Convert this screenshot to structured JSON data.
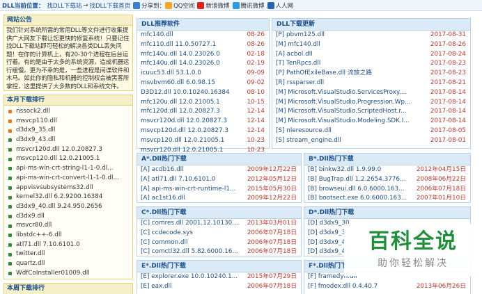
{
  "topbar": {
    "location_label": "DLL当前位置：",
    "crumb1": "找DLL下载站",
    "arrow": "→",
    "crumb2": "找DLL下载首页",
    "share_label": "分享到：",
    "share_items": [
      "QQ空间",
      "新浪微博",
      "腾讯微博",
      "人人网"
    ],
    "share_colors": [
      "#f5a623",
      "#e2231a",
      "#2b9ae3",
      "#2a62b0"
    ]
  },
  "notice": {
    "title": "网站公告",
    "text": "我们针对系统所需的常用DLL等文件进行收集提供广大网友下载让您更快的修复系统！只要记住找DLL下载站即可轻松的解决各类DLL丢失问题！在你的计算机上，有20-30个进程在后台运行着。有的是由于太多的系统资源，造成机器运行缓慢。更为不幸的是，一些进程是间谍软件和木马。如此你的隐私和机器的控制权会被黑客所掌控，这里提供了大多数的DLL和系统文件。"
  },
  "ranking": {
    "title": "本月下载排行",
    "items": [
      "nssock2.dll",
      "msvcp110.dll",
      "d3dx9_35.dll",
      "d3dx9_43.dll",
      "msvcr120d.dll 12.0.20827.3",
      "msvcp120.dll 12.0.21005.1",
      "api-ms-win-crt-string-l1-1-0.dl...",
      "api-ms-win-crt-convert-l1-1-0.dl...",
      "appvisvsubsystems32.dll",
      "kernel32.dll 6.2.9200.16384",
      "d3dx9_40.dll 9.24.950.2656",
      "d3dx9.dll",
      "msvcr80.dll",
      "libstdc++-6.dll",
      "atl71.dll 7.10.6101.0",
      "twitter.dll",
      "quartz.dll",
      "WdfCoInstaller01009.dll"
    ],
    "dot_colors": [
      "#e8761c",
      "#e8761c",
      "#e8761c",
      "#2e8b3a",
      "#2e8b3a",
      "#2e8b3a",
      "#2e8b3a",
      "#2e8b3a",
      "#2e8b3a",
      "#2e8b3a",
      "#2e8b3a",
      "#2e8b3a",
      "#2e8b3a",
      "#2e8b3a",
      "#2e8b3a",
      "#2e8b3a",
      "#2e8b3a",
      "#2e8b3a"
    ]
  },
  "ranking2": {
    "title": "本周下载排行"
  },
  "recommend": {
    "title": "DLL推荐软件",
    "rows": [
      {
        "name": "mfc140.dll",
        "date": "08-26"
      },
      {
        "name": "mfc110.dll 11.0.50727.1",
        "date": "08-26"
      },
      {
        "name": "mfc140u.dll 14.0.23026.0",
        "date": "02-18"
      },
      {
        "name": "mfc140u.dll 14.0.23026.0",
        "date": "02-19"
      },
      {
        "name": "icuuc53.dll 53.1.0.0",
        "date": "09-09"
      },
      {
        "name": "msvbvm60.dll 6.0.98.15",
        "date": "09-02"
      },
      {
        "name": "D3D12.dll 10.0.10240.16384",
        "date": "08-10"
      },
      {
        "name": "mfc120u.dll 12.0.21005.1",
        "date": "10-15"
      },
      {
        "name": "mfc120d.dll 12.0.20827.3",
        "date": "12-14"
      },
      {
        "name": "msvcr120d.dll 12.0.20827.3",
        "date": "12-14"
      },
      {
        "name": "msvcp120d.dll 12.0.20827.3",
        "date": "12-14"
      },
      {
        "name": "msvcp120.dll 12.0.21005.1",
        "date": "10-23"
      },
      {
        "name": "msvcr120.dll 12.0.21005.1",
        "date": "10-23"
      }
    ]
  },
  "updates": {
    "title": "DLL下载更新",
    "rows": [
      {
        "name": "[P] pbvm125.dll",
        "date": "2017-08-31"
      },
      {
        "name": "[M] mfc140.dll",
        "date": "2017-08-26"
      },
      {
        "name": "[A] acbol.dll",
        "date": "2017-08-24"
      },
      {
        "name": "[T] TenRpcs.dll",
        "date": "2017-08-23"
      },
      {
        "name": "[P] PathOfExileBase.dll 流放之路",
        "date": "2017-08-23"
      },
      {
        "name": "[R] rssparser.dll",
        "date": "2017-08-21"
      },
      {
        "name": "[M] Microsoft.VisualStudio.ServicesProxy....",
        "date": "2017-08-14"
      },
      {
        "name": "[M] Microsoft.VisualStudio.Progression.Wp...",
        "date": "2017-08-14"
      },
      {
        "name": "[M] Microsoft.VisualStudio.ScriptedHost.r...",
        "date": "2017-08-14"
      },
      {
        "name": "[M] Microsoft.VisualStudio.Modeling.SDK.I...",
        "date": "2017-08-14"
      },
      {
        "name": "[S] nleresource.dll",
        "date": "2017-08-05"
      },
      {
        "name": "[S] stream_engine.dll",
        "date": "2017-08-01"
      }
    ]
  },
  "hot_a": {
    "title": "A*.Dll热门下载",
    "rows": [
      {
        "name": "[A] acdb16.dll",
        "date": "2009年12月22日"
      },
      {
        "name": "[A] atl71.dll 7.10.6101.0",
        "date": "2012年05月12日"
      },
      {
        "name": "[A] api-ms-win-crt-runtime-l1...",
        "date": "2015年05月30日"
      },
      {
        "name": "[A] ac1st16.dll",
        "date": "2009年12月22日"
      }
    ]
  },
  "hot_b": {
    "title": "B*.Dll热门下载",
    "rows": [
      {
        "name": "[B] binkw32.dll 1.9.99.0",
        "date": "2012年04月15日"
      },
      {
        "name": "[B] BugTrap.dll 1.2.2654.3776...",
        "date": "2008年06月22日"
      },
      {
        "name": "[B] browseui.dll 6.0.6000.163...",
        "date": "2006年07月18日"
      },
      {
        "name": "[B] bootsect.exe 6.0.6000.163...",
        "date": "2007年01月10日"
      }
    ]
  },
  "hot_c": {
    "title": "C*.Dll热门下载",
    "rows": [
      {
        "name": "[C] comres.dll 2001.12.10130....",
        "date": "2013年03月01日"
      },
      {
        "name": "[C] ccdecode.sys",
        "date": "2006年07月18日"
      },
      {
        "name": "[C] common.dll",
        "date": "2006年07月18日"
      },
      {
        "name": "[C] comctl32.dll 5.82.6000.16...",
        "date": "2006年07月18日"
      }
    ]
  },
  "hot_d": {
    "title": "D*.Dll热门下载",
    "rows": [
      {
        "name": "[D] d3dx9_30",
        "date": ""
      },
      {
        "name": "[D] d3dx9_3",
        "date": ""
      },
      {
        "name": "[D] d3dx9_4",
        "date": ""
      },
      {
        "name": "[D] d3dx9_41",
        "date": ""
      }
    ]
  },
  "hot_e": {
    "title": "E*.Dll热门下载",
    "rows": [
      {
        "name": "[E] explorer.exe 10.0.10240.1...",
        "date": "2015年07月29日"
      },
      {
        "name": "[E] eax.dll",
        "date": "2006年07月18日"
      }
    ]
  },
  "hot_f": {
    "title": "F*.Dll热门下",
    "rows": [
      {
        "name": "[F] framedyn.dll",
        "date": ""
      },
      {
        "name": "[F] fmodex.dll 0.4.40.7",
        "date": "2013年06月26日"
      }
    ]
  },
  "watermark": {
    "big": "百科全说",
    "small": "助你轻松解决"
  }
}
